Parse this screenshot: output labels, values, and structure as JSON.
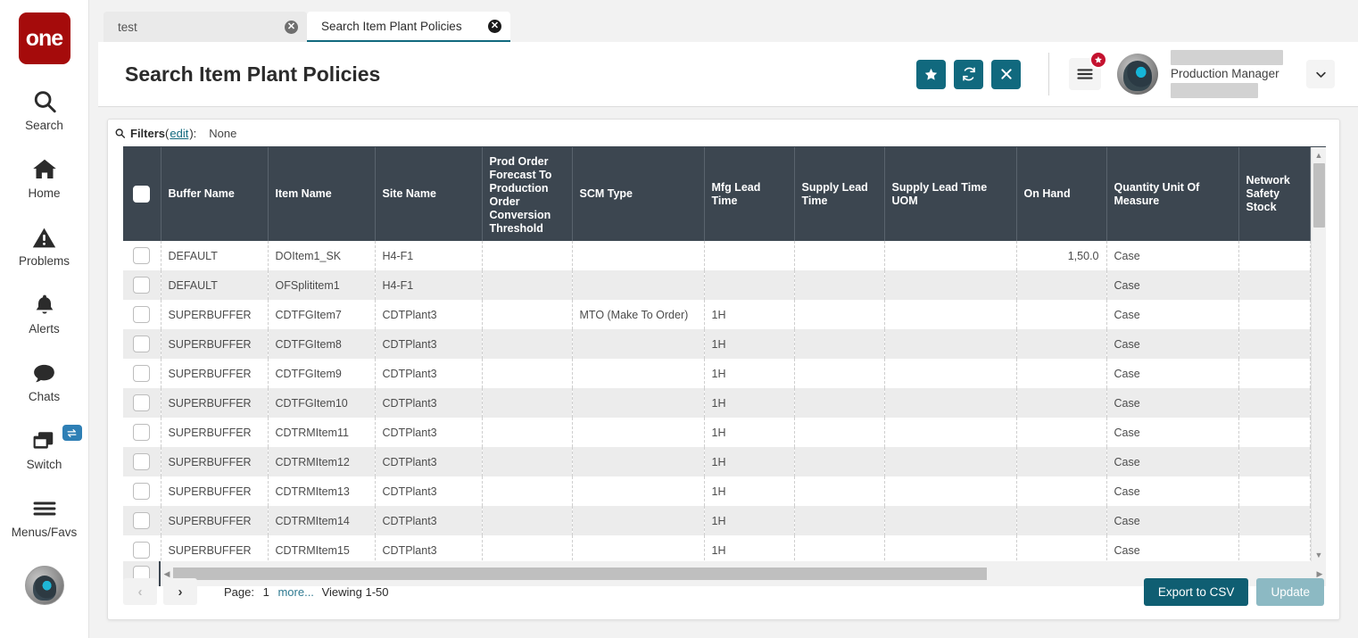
{
  "brand": {
    "logo_text": "one",
    "logo_color": "#a50b0b"
  },
  "accent": {
    "teal": "#11697e",
    "dark_teal": "#0f5e72",
    "muted_teal": "#8cb9c3",
    "header_row": "#3c4650",
    "link": "#2f7a91",
    "badge_red": "#c4122f"
  },
  "rail": {
    "items": [
      {
        "label": "Search",
        "icon": "search-icon"
      },
      {
        "label": "Home",
        "icon": "home-icon"
      },
      {
        "label": "Problems",
        "icon": "warning-triangle-icon"
      },
      {
        "label": "Alerts",
        "icon": "bell-icon"
      },
      {
        "label": "Chats",
        "icon": "chat-bubble-icon"
      },
      {
        "label": "Switch",
        "icon": "windows-stack-icon",
        "badge_icon": "swap-arrows-icon"
      },
      {
        "label": "Menus/Favs",
        "icon": "hamburger-icon"
      }
    ]
  },
  "tabs": [
    {
      "label": "test",
      "active": false,
      "close_icon": "close-circle-icon"
    },
    {
      "label": "Search Item Plant Policies",
      "active": true,
      "close_icon": "close-circle-icon"
    }
  ],
  "header": {
    "title": "Search Item Plant Policies",
    "actions": [
      {
        "name": "favorite-button",
        "icon": "star-icon",
        "glyph": "★"
      },
      {
        "name": "refresh-button",
        "icon": "refresh-icon",
        "glyph": "↻"
      },
      {
        "name": "close-button",
        "icon": "x-icon",
        "glyph": "✕"
      }
    ],
    "menu_icon": "hamburger-icon",
    "menu_badge_icon": "star-icon",
    "user_role": "Production Manager",
    "caret_icon": "chevron-down-icon",
    "avatar_icon": "user-avatar"
  },
  "filters": {
    "icon": "search-icon",
    "label": "Filters",
    "edit_link": "edit",
    "colon": "):",
    "open_paren": "(",
    "value": "None"
  },
  "table": {
    "columns": [
      "Buffer Name",
      "Item Name",
      "Site Name",
      "Prod Order Forecast To Production Order Conversion Threshold",
      "SCM Type",
      "Mfg Lead Time",
      "Supply Lead Time",
      "Supply Lead Time UOM",
      "On Hand",
      "Quantity Unit Of Measure",
      "Network Safety Stock"
    ],
    "rows": [
      {
        "buffer_name": "DEFAULT",
        "item_name": "DOItem1_SK",
        "site_name": "H4-F1",
        "prod_order_threshold": "",
        "scm_type": "",
        "mfg_lead_time": "",
        "supply_lead_time": "",
        "supply_lead_time_uom": "",
        "on_hand": "1,50.0",
        "quantity_uom": "Case",
        "network_safety_stock": ""
      },
      {
        "buffer_name": "DEFAULT",
        "item_name": "OFSplititem1",
        "site_name": "H4-F1",
        "prod_order_threshold": "",
        "scm_type": "",
        "mfg_lead_time": "",
        "supply_lead_time": "",
        "supply_lead_time_uom": "",
        "on_hand": "",
        "quantity_uom": "Case",
        "network_safety_stock": ""
      },
      {
        "buffer_name": "SUPERBUFFER",
        "item_name": "CDTFGItem7",
        "site_name": "CDTPlant3",
        "prod_order_threshold": "",
        "scm_type": "MTO (Make To Order)",
        "mfg_lead_time": "1H",
        "supply_lead_time": "",
        "supply_lead_time_uom": "",
        "on_hand": "",
        "quantity_uom": "Case",
        "network_safety_stock": ""
      },
      {
        "buffer_name": "SUPERBUFFER",
        "item_name": "CDTFGItem8",
        "site_name": "CDTPlant3",
        "prod_order_threshold": "",
        "scm_type": "",
        "mfg_lead_time": "1H",
        "supply_lead_time": "",
        "supply_lead_time_uom": "",
        "on_hand": "",
        "quantity_uom": "Case",
        "network_safety_stock": ""
      },
      {
        "buffer_name": "SUPERBUFFER",
        "item_name": "CDTFGItem9",
        "site_name": "CDTPlant3",
        "prod_order_threshold": "",
        "scm_type": "",
        "mfg_lead_time": "1H",
        "supply_lead_time": "",
        "supply_lead_time_uom": "",
        "on_hand": "",
        "quantity_uom": "Case",
        "network_safety_stock": ""
      },
      {
        "buffer_name": "SUPERBUFFER",
        "item_name": "CDTFGItem10",
        "site_name": "CDTPlant3",
        "prod_order_threshold": "",
        "scm_type": "",
        "mfg_lead_time": "1H",
        "supply_lead_time": "",
        "supply_lead_time_uom": "",
        "on_hand": "",
        "quantity_uom": "Case",
        "network_safety_stock": ""
      },
      {
        "buffer_name": "SUPERBUFFER",
        "item_name": "CDTRMItem11",
        "site_name": "CDTPlant3",
        "prod_order_threshold": "",
        "scm_type": "",
        "mfg_lead_time": "1H",
        "supply_lead_time": "",
        "supply_lead_time_uom": "",
        "on_hand": "",
        "quantity_uom": "Case",
        "network_safety_stock": ""
      },
      {
        "buffer_name": "SUPERBUFFER",
        "item_name": "CDTRMItem12",
        "site_name": "CDTPlant3",
        "prod_order_threshold": "",
        "scm_type": "",
        "mfg_lead_time": "1H",
        "supply_lead_time": "",
        "supply_lead_time_uom": "",
        "on_hand": "",
        "quantity_uom": "Case",
        "network_safety_stock": ""
      },
      {
        "buffer_name": "SUPERBUFFER",
        "item_name": "CDTRMItem13",
        "site_name": "CDTPlant3",
        "prod_order_threshold": "",
        "scm_type": "",
        "mfg_lead_time": "1H",
        "supply_lead_time": "",
        "supply_lead_time_uom": "",
        "on_hand": "",
        "quantity_uom": "Case",
        "network_safety_stock": ""
      },
      {
        "buffer_name": "SUPERBUFFER",
        "item_name": "CDTRMItem14",
        "site_name": "CDTPlant3",
        "prod_order_threshold": "",
        "scm_type": "",
        "mfg_lead_time": "1H",
        "supply_lead_time": "",
        "supply_lead_time_uom": "",
        "on_hand": "",
        "quantity_uom": "Case",
        "network_safety_stock": ""
      },
      {
        "buffer_name": "SUPERBUFFER",
        "item_name": "CDTRMItem15",
        "site_name": "CDTPlant3",
        "prod_order_threshold": "",
        "scm_type": "",
        "mfg_lead_time": "1H",
        "supply_lead_time": "",
        "supply_lead_time_uom": "",
        "on_hand": "",
        "quantity_uom": "Case",
        "network_safety_stock": ""
      }
    ]
  },
  "pagination": {
    "prev_icon": "chevron-left-icon",
    "next_icon": "chevron-right-icon",
    "page_label": "Page:",
    "page_number": "1",
    "more_link": "more...",
    "viewing": "Viewing 1-50"
  },
  "footer_buttons": {
    "export_label": "Export to CSV",
    "update_label": "Update"
  }
}
